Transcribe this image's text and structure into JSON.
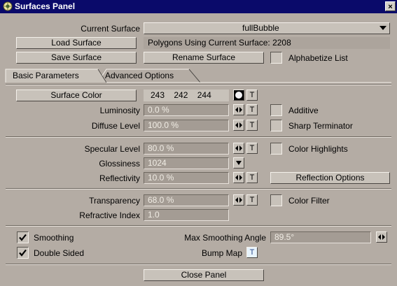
{
  "window": {
    "title": "Surfaces Panel",
    "close_glyph": "×"
  },
  "surface": {
    "current_label": "Current Surface",
    "current_value": "fullBubble",
    "load_label": "Load Surface",
    "polygons_text": "Polygons Using Current Surface: 2208",
    "save_label": "Save Surface",
    "rename_label": "Rename Surface",
    "alphabetize_label": "Alphabetize List",
    "alphabetize_checked": false
  },
  "tabs": [
    {
      "label": "Basic Parameters",
      "active": true
    },
    {
      "label": "Advanced Options",
      "active": false
    }
  ],
  "color": {
    "button_label": "Surface Color",
    "r": "243",
    "g": "242",
    "b": "244",
    "t_label": "T"
  },
  "rows": {
    "luminosity": {
      "label": "Luminosity",
      "value": "0.0 %",
      "t_label": "T"
    },
    "diffuse": {
      "label": "Diffuse Level",
      "value": "100.0 %",
      "t_label": "T"
    },
    "specular": {
      "label": "Specular Level",
      "value": "80.0 %",
      "t_label": "T"
    },
    "glossiness": {
      "label": "Glossiness",
      "value": "1024"
    },
    "reflectivity": {
      "label": "Reflectivity",
      "value": "10.0 %",
      "t_label": "T"
    },
    "transparency": {
      "label": "Transparency",
      "value": "68.0 %",
      "t_label": "T"
    },
    "refractive": {
      "label": "Refractive Index",
      "value": "1.0"
    }
  },
  "options": {
    "additive": {
      "label": "Additive",
      "checked": false
    },
    "sharp_terminator": {
      "label": "Sharp Terminator",
      "checked": false
    },
    "color_highlights": {
      "label": "Color Highlights",
      "checked": false
    },
    "reflection_options": "Reflection Options",
    "color_filter": {
      "label": "Color Filter",
      "checked": false
    }
  },
  "bottom": {
    "smoothing": {
      "label": "Smoothing",
      "checked": true
    },
    "double_sided": {
      "label": "Double Sided",
      "checked": true
    },
    "max_smoothing_label": "Max Smoothing Angle",
    "max_smoothing_value": "89.5°",
    "bump_map_label": "Bump Map",
    "bump_map_t": "T",
    "close_label": "Close Panel"
  },
  "icons": {
    "app": "lightwave-icon",
    "dropdown": "chevron-down-icon",
    "slider": "left-right-arrows-icon",
    "checkmark": "checkmark-icon"
  },
  "colors": {
    "title_bar": "#0a0a6a",
    "panel_bg": "#b4aca4",
    "field_bg": "#a49c94",
    "check": "#000000"
  }
}
